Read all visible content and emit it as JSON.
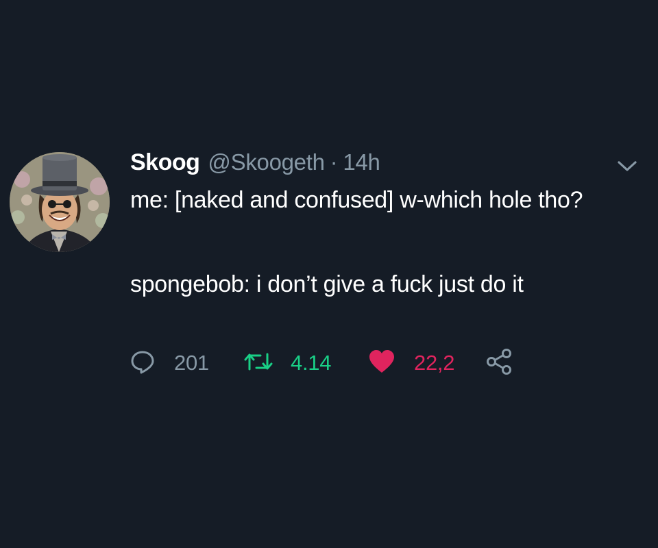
{
  "tweet": {
    "display_name": "Skoog",
    "handle": "@Skoogeth",
    "separator": "·",
    "time": "14h",
    "text_line1": "me: [naked and confused] w-which hole tho?",
    "text_line2": "spongebob: i don’t give a fuck just do it",
    "menu_icon": "chevron-down-icon"
  },
  "actions": {
    "reply": {
      "icon": "reply-icon",
      "count": "201"
    },
    "retweet": {
      "icon": "retweet-icon",
      "count": "4.14",
      "color": "#19cf86"
    },
    "like": {
      "icon": "heart-icon",
      "count": "22,2",
      "color": "#e0245e"
    },
    "share": {
      "icon": "share-icon"
    }
  },
  "colors": {
    "background": "#151c26",
    "secondary_text": "#8899a6"
  }
}
